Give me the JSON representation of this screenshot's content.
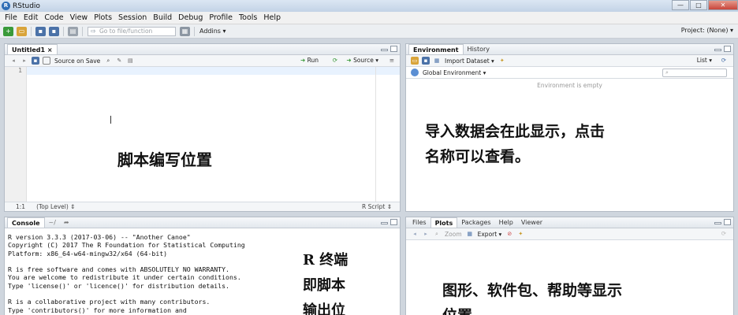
{
  "window": {
    "title": "RStudio",
    "controls": {
      "minimize": "—",
      "maximize": "□",
      "close": "✕"
    }
  },
  "menu": [
    "File",
    "Edit",
    "Code",
    "View",
    "Plots",
    "Session",
    "Build",
    "Debug",
    "Profile",
    "Tools",
    "Help"
  ],
  "toolbar": {
    "goto_placeholder": "Go to file/function",
    "addins_label": "Addins ▾",
    "project_label": "Project: (None) ▾"
  },
  "source_pane": {
    "tab_label": "Untitled1 ×",
    "source_on_save": "Source on Save",
    "run_label": "Run",
    "source_label": "Source ▾",
    "line_number": "1",
    "status_position": "1:1",
    "status_scope": "(Top Level) ⇕",
    "status_type": "R Script ⇕",
    "annotation": "脚本编写位置"
  },
  "env_pane": {
    "tabs": [
      "Environment",
      "History"
    ],
    "import_label": "Import Dataset ▾",
    "list_label": "List ▾",
    "scope_label": "Global Environment ▾",
    "empty_text": "Environment is empty",
    "annotation_line1": "导入数据会在此显示，点击",
    "annotation_line2": "名称可以查看。"
  },
  "console_pane": {
    "tab_label": "Console",
    "path": "~/",
    "lines": [
      "R version 3.3.3 (2017-03-06) -- \"Another Canoe\"",
      "Copyright (C) 2017 The R Foundation for Statistical Computing",
      "Platform: x86_64-w64-mingw32/x64 (64-bit)",
      "",
      "R is free software and comes with ABSOLUTELY NO WARRANTY.",
      "You are welcome to redistribute it under certain conditions.",
      "Type 'license()' or 'licence()' for distribution details.",
      "",
      "R is a collaborative project with many contributors.",
      "Type 'contributors()' for more information and"
    ],
    "annotation_line1": "R 终端",
    "annotation_line2": "即脚本",
    "annotation_line3": "输出位"
  },
  "files_pane": {
    "tabs": [
      "Files",
      "Plots",
      "Packages",
      "Help",
      "Viewer"
    ],
    "zoom_label": "Zoom",
    "export_label": "Export ▾",
    "annotation_line1": "图形、软件包、帮助等显示",
    "annotation_line2": "位置"
  },
  "colors": {
    "accent": "#2f6db5",
    "titlebar": "#c3d3e6",
    "pane_border": "#b4bcc6"
  }
}
